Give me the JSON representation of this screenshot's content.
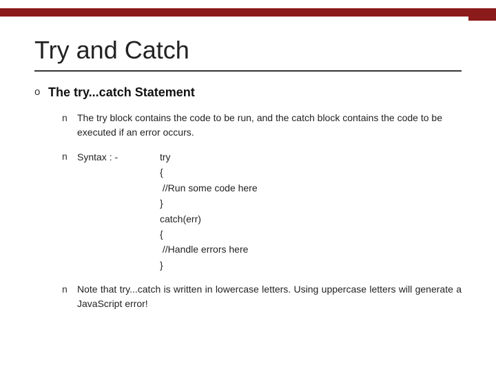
{
  "topbar": {
    "color": "#8B1A1A"
  },
  "page": {
    "title": "Try and Catch"
  },
  "section": {
    "title": "The try...catch Statement",
    "bullet1": {
      "text": "The try block contains the code to be run, and the catch block contains the code to be executed if an error occurs."
    },
    "bullet2": {
      "syntax_label": "Syntax : -",
      "code_lines": [
        "try",
        "{",
        " //Run some code here",
        "}",
        "catch(err)",
        "{",
        " //Handle errors here",
        "}"
      ]
    },
    "bullet3": {
      "text": "Note that try...catch is written in lowercase letters. Using uppercase letters will generate a JavaScript error!"
    }
  }
}
